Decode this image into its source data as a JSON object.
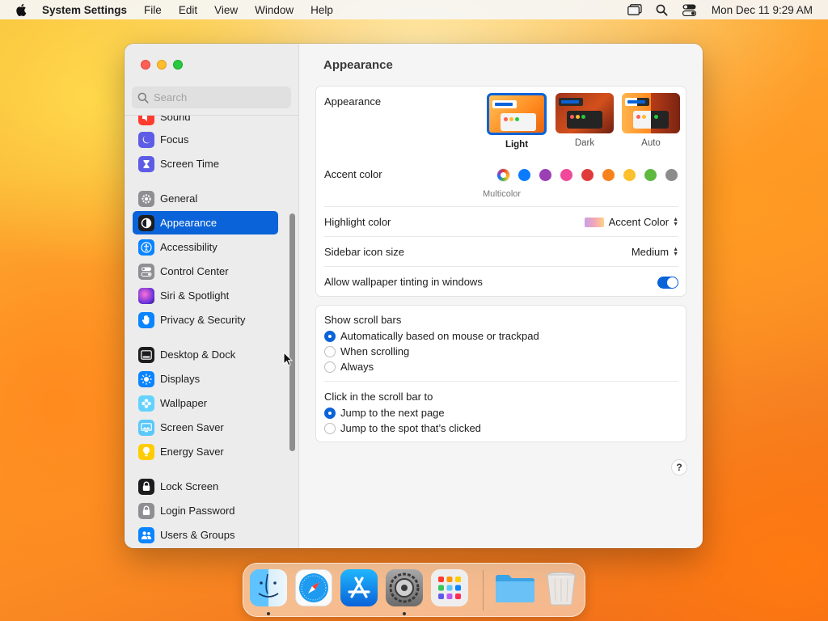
{
  "menubar": {
    "app_name": "System Settings",
    "menus": [
      "File",
      "Edit",
      "View",
      "Window",
      "Help"
    ],
    "clock": "Mon Dec 11  9:29 AM",
    "icons": [
      "apple-logo-icon",
      "window-stack-icon",
      "spotlight-search-icon",
      "control-center-icon"
    ]
  },
  "window": {
    "controls": [
      "close",
      "minimize",
      "zoom"
    ],
    "search": {
      "placeholder": "Search",
      "value": ""
    },
    "sidebar": {
      "items": [
        {
          "label": "Sound",
          "icon": "speaker-icon",
          "color": "#ff3b30"
        },
        {
          "label": "Focus",
          "icon": "moon-icon",
          "color": "#5e5ce6"
        },
        {
          "label": "Screen Time",
          "icon": "hourglass-icon",
          "color": "#5e5ce6"
        },
        {
          "label": "General",
          "icon": "gear-icon",
          "color": "#8e8e93"
        },
        {
          "label": "Appearance",
          "icon": "appearance-icon",
          "color": "#1d1d1f",
          "selected": true
        },
        {
          "label": "Accessibility",
          "icon": "accessibility-icon",
          "color": "#0a84ff"
        },
        {
          "label": "Control Center",
          "icon": "switches-icon",
          "color": "#8e8e93"
        },
        {
          "label": "Siri & Spotlight",
          "icon": "siri-icon",
          "color": "#bf5af2"
        },
        {
          "label": "Privacy & Security",
          "icon": "hand-icon",
          "color": "#0a84ff"
        },
        {
          "label": "Desktop & Dock",
          "icon": "dock-icon",
          "color": "#1d1d1f"
        },
        {
          "label": "Displays",
          "icon": "sun-icon",
          "color": "#0a84ff"
        },
        {
          "label": "Wallpaper",
          "icon": "flower-icon",
          "color": "#64d2ff"
        },
        {
          "label": "Screen Saver",
          "icon": "screen-saver-icon",
          "color": "#5ac8fa"
        },
        {
          "label": "Energy Saver",
          "icon": "lightbulb-icon",
          "color": "#ffcc00"
        },
        {
          "label": "Lock Screen",
          "icon": "lock-icon",
          "color": "#1d1d1f"
        },
        {
          "label": "Login Password",
          "icon": "lock-small-icon",
          "color": "#8e8e93"
        },
        {
          "label": "Users & Groups",
          "icon": "users-icon",
          "color": "#0a84ff"
        }
      ]
    },
    "main": {
      "title": "Appearance",
      "appearance": {
        "label": "Appearance",
        "options": [
          "Light",
          "Dark",
          "Auto"
        ],
        "selected": "Light"
      },
      "accent": {
        "label": "Accent color",
        "caption": "Multicolor",
        "colors": [
          "multicolor",
          "#0a7aff",
          "#9b3fb5",
          "#f0489b",
          "#e03b3b",
          "#f7821b",
          "#fcc02c",
          "#5fb83f",
          "#8c8c8c"
        ]
      },
      "highlight": {
        "label": "Highlight color",
        "value": "Accent Color"
      },
      "icon_size": {
        "label": "Sidebar icon size",
        "value": "Medium"
      },
      "tinting": {
        "label": "Allow wallpaper tinting in windows",
        "on": true
      },
      "scroll_bars": {
        "label": "Show scroll bars",
        "options": [
          "Automatically based on mouse or trackpad",
          "When scrolling",
          "Always"
        ],
        "selected": 0
      },
      "click_scroll": {
        "label": "Click in the scroll bar to",
        "options": [
          "Jump to the next page",
          "Jump to the spot that’s clicked"
        ],
        "selected": 0
      },
      "help": "?"
    }
  },
  "dock": {
    "apps": [
      "finder-icon",
      "safari-icon",
      "app-store-icon",
      "system-settings-icon",
      "launchpad-icon",
      "downloads-folder-icon",
      "trash-icon"
    ]
  }
}
